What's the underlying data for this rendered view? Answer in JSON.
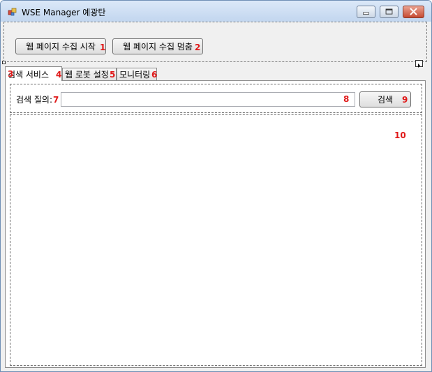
{
  "window": {
    "title": "WSE Manager 예광탄"
  },
  "toolbar": {
    "start_label": "웹 페이지 수집 시작",
    "stop_label": "웹 페이지 수집 멈춤"
  },
  "tabs": [
    {
      "label": "검색 서비스",
      "active": true
    },
    {
      "label": "웹 로봇 설정",
      "active": false
    },
    {
      "label": "모니터링",
      "active": false
    }
  ],
  "search": {
    "label": "검색 질의:",
    "value": "",
    "placeholder": "",
    "button_label": "검색"
  },
  "markers": [
    "1",
    "2",
    "3",
    "4",
    "5",
    "6",
    "7",
    "8",
    "9",
    "10"
  ],
  "colors": {
    "marker": "#e01818",
    "titlebar": "#c2d6ef",
    "close_button": "#c64b33"
  }
}
